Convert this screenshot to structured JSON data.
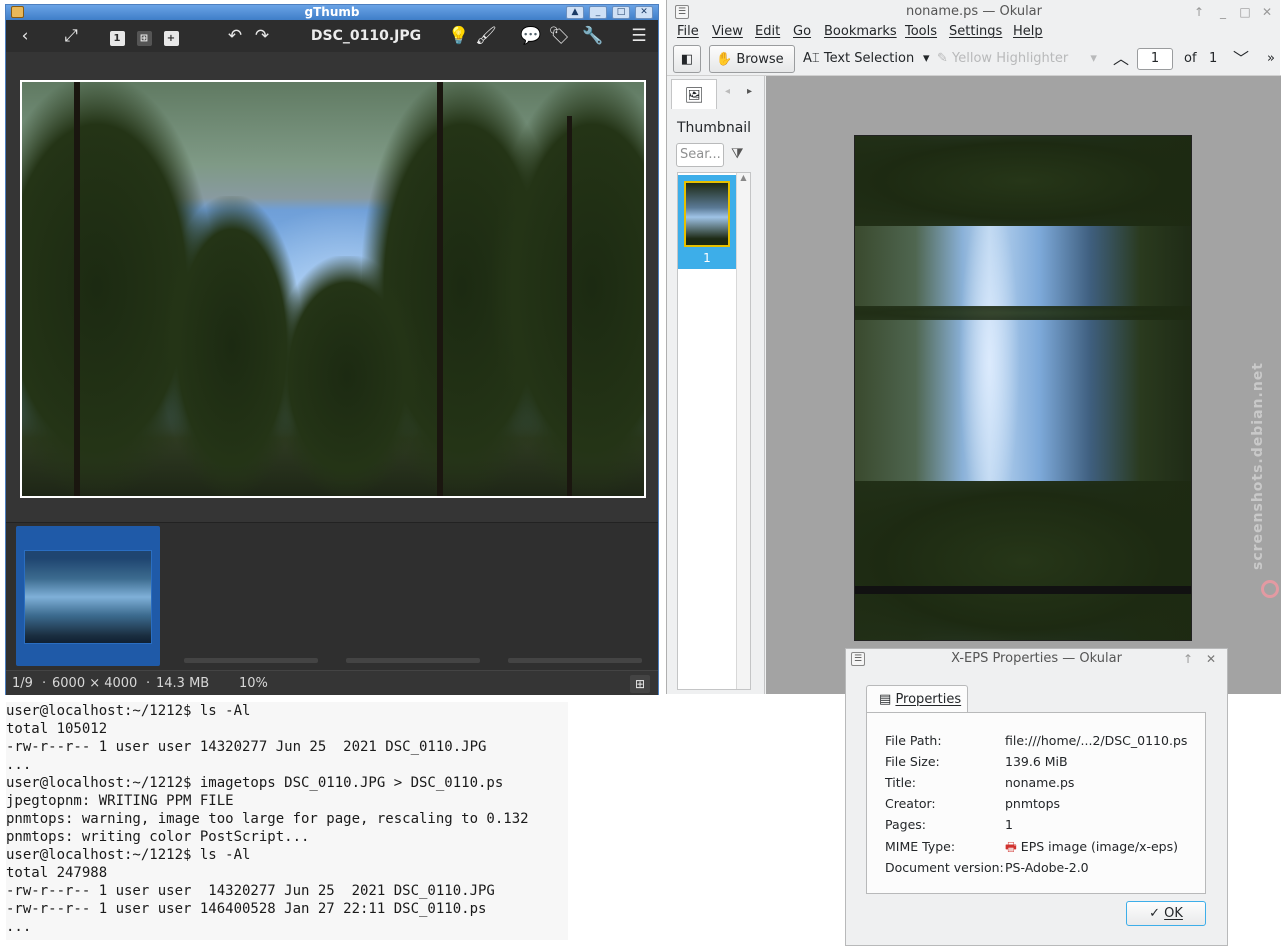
{
  "gthumb": {
    "window_title": "gThumb",
    "filename": "DSC_0110.JPG",
    "status": {
      "position": "1/9",
      "dimensions": "6000 × 4000",
      "size": "14.3 MB",
      "zoom": "10%"
    }
  },
  "okular": {
    "window_title": "noname.ps — Okular",
    "menu": [
      "File",
      "View",
      "Edit",
      "Go",
      "Bookmarks",
      "Tools",
      "Settings",
      "Help"
    ],
    "toolbar": {
      "browse": "Browse",
      "text_selection": "Text Selection",
      "highlighter": "Yellow Highlighter",
      "page_current": "1",
      "page_of": "of",
      "page_total": "1"
    },
    "sidebar": {
      "heading": "Thumbnail",
      "search_placeholder": "Sear...",
      "thumbnail_label": "1"
    }
  },
  "terminal": {
    "lines": [
      "user@localhost:~/1212$ ls -Al",
      "total 105012",
      "-rw-r--r-- 1 user user 14320277 Jun 25  2021 DSC_0110.JPG",
      "...",
      "user@localhost:~/1212$ imagetops DSC_0110.JPG > DSC_0110.ps",
      "jpegtopnm: WRITING PPM FILE",
      "pnmtops: warning, image too large for page, rescaling to 0.132",
      "pnmtops: writing color PostScript...",
      "user@localhost:~/1212$ ls -Al",
      "total 247988",
      "-rw-r--r-- 1 user user  14320277 Jun 25  2021 DSC_0110.JPG",
      "-rw-r--r-- 1 user user 146400528 Jan 27 22:11 DSC_0110.ps",
      "..."
    ]
  },
  "properties": {
    "window_title": "X-EPS Properties — Okular",
    "tab": "Properties",
    "rows": [
      {
        "label": "File Path:",
        "value": "file:///home/...2/DSC_0110.ps"
      },
      {
        "label": "File Size:",
        "value": "139.6 MiB"
      },
      {
        "label": "Title:",
        "value": "noname.ps"
      },
      {
        "label": "Creator:",
        "value": "pnmtops"
      },
      {
        "label": "Pages:",
        "value": "1"
      },
      {
        "label": "MIME Type:",
        "value": "EPS image (image/x-eps)"
      },
      {
        "label": "Document version:",
        "value": "PS-Adobe-2.0"
      }
    ],
    "ok_label": "OK"
  },
  "watermark": "screenshots.debian.net",
  "colors": {
    "gthumb_bg": "#353535",
    "okular_bg": "#eff0f1",
    "selection": "#3daee9",
    "gthumb_selection": "#1f5aa8"
  }
}
